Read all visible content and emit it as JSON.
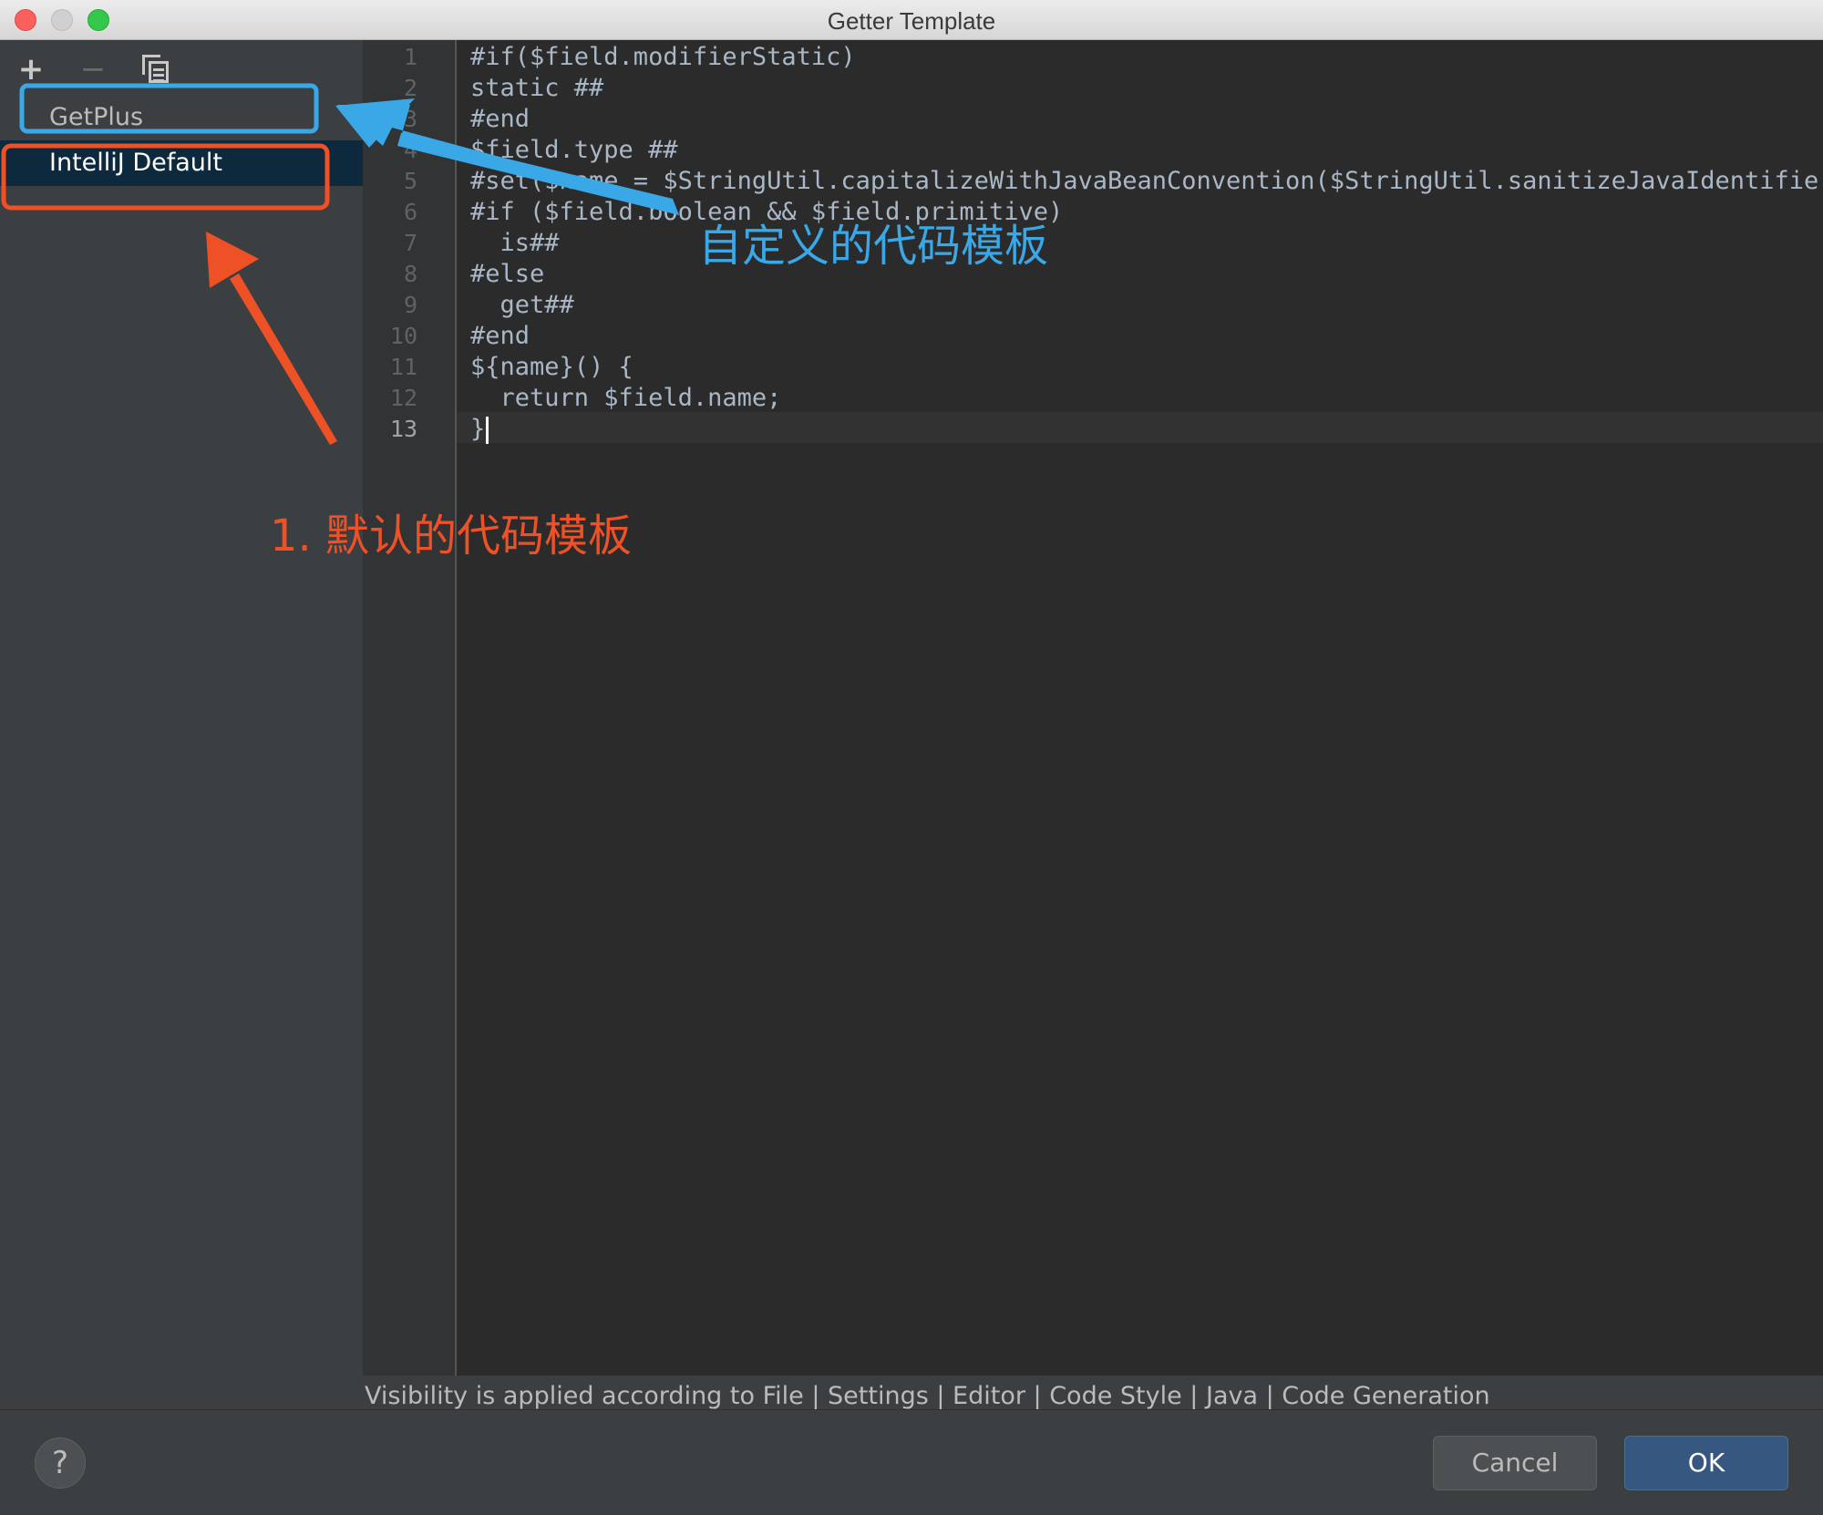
{
  "window": {
    "title": "Getter Template"
  },
  "toolbar": {
    "add_label": "+",
    "remove_label": "−",
    "copy_icon": "copy-icon"
  },
  "templates": [
    {
      "label": "GetPlus",
      "selected": false
    },
    {
      "label": "IntelliJ Default",
      "selected": true
    }
  ],
  "editor": {
    "line_numbers": [
      "1",
      "2",
      "3",
      "4",
      "5",
      "6",
      "7",
      "8",
      "9",
      "10",
      "11",
      "12",
      "13"
    ],
    "active_line": 13,
    "lines": [
      "#if($field.modifierStatic)",
      "static ##",
      "#end",
      "$field.type ##",
      "#set($name = $StringUtil.capitalizeWithJavaBeanConvention($StringUtil.sanitizeJavaIdentifier(",
      "#if ($field.boolean && $field.primitive)",
      "  is##",
      "#else",
      "  get##",
      "#end",
      "${name}() {",
      "  return $field.name;",
      "}"
    ]
  },
  "hint_text": "Visibility is applied according to File | Settings | Editor | Code Style | Java | Code Generation",
  "footer": {
    "help_label": "?",
    "cancel_label": "Cancel",
    "ok_label": "OK"
  },
  "annotations": {
    "custom_label": "自定义的代码模板",
    "default_label": "1. 默认的代码模板",
    "custom_color": "#3aa8e6",
    "default_color": "#ef5127"
  },
  "colors": {
    "selection_bg": "#0d293e",
    "editor_bg": "#2b2b2b",
    "panel_bg": "#3c3f41",
    "ok_button": "#365880"
  }
}
